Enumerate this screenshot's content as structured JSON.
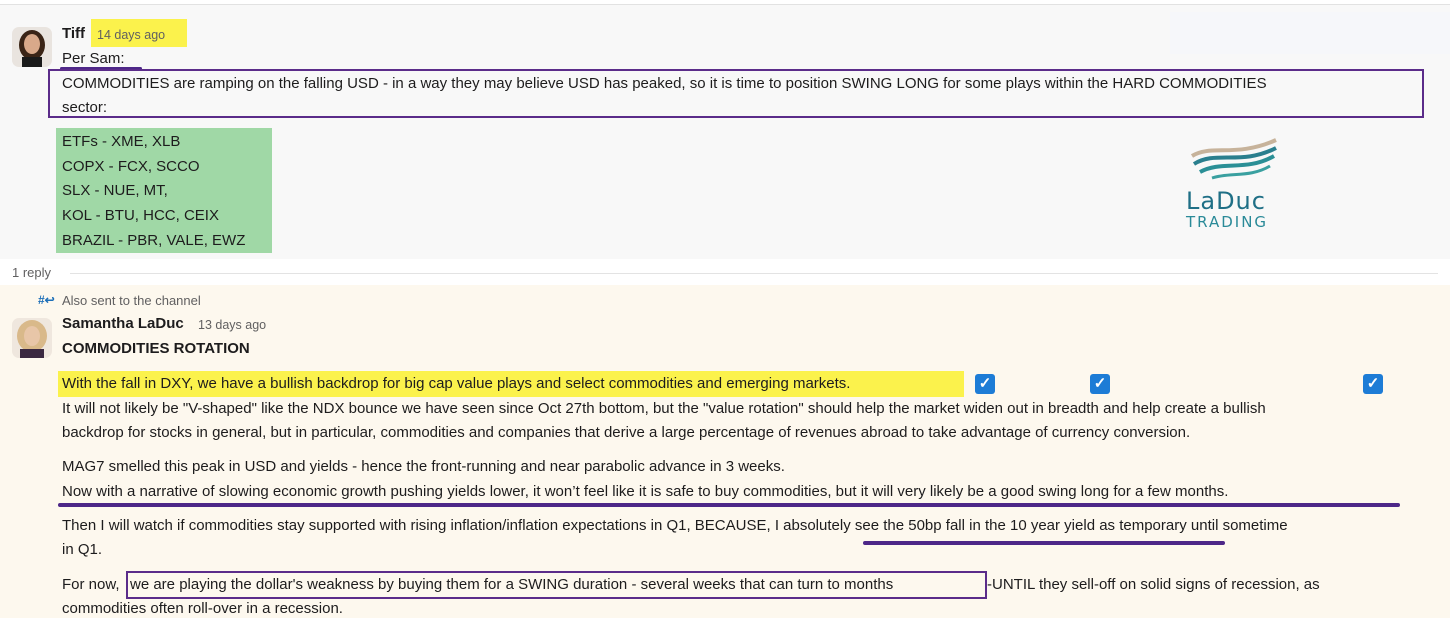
{
  "message1": {
    "author": "Tiff",
    "timestamp": "14 days ago",
    "lines": [
      "Per Sam:",
      "COMMODITIES are ramping on the falling USD - in a way they may believe USD has peaked, so it is time to position SWING LONG for some plays within the HARD COMMODITIES",
      "sector:"
    ],
    "list": [
      "ETFs - XME, XLB",
      "COPX - FCX, SCCO",
      "SLX - NUE, MT,",
      "KOL - BTU, HCC, CEIX",
      "BRAZIL - PBR, VALE, EWZ"
    ],
    "logo": {
      "line1": "LaDuc",
      "line2": "TRADING"
    }
  },
  "thread": {
    "reply_count": "1 reply"
  },
  "message2": {
    "also_sent": "Also sent to the channel",
    "author": "Samantha LaDuc",
    "timestamp": "13 days ago",
    "title": "COMMODITIES ROTATION",
    "highlight": "With the fall in DXY, we have a bullish backdrop for big cap value plays and select commodities and emerging markets.",
    "checks": [
      "✓",
      "✓",
      "✓"
    ],
    "p1a": "It will not likely be \"V-shaped\" like the NDX bounce we have seen since Oct 27th bottom, but the \"value rotation\" should help the market widen out in breadth and help create a bullish",
    "p1b": "backdrop for stocks in general, but in particular, commodities and companies that derive a large percentage of revenues abroad to take advantage of currency conversion.",
    "p2a": "MAG7 smelled this peak in USD and yields - hence the front-running and near parabolic advance in 3 weeks.",
    "p2b": "Now with a narrative of slowing economic growth pushing yields lower, it won’t feel like it is safe to buy commodities, but it will very likely be a good swing long for a few months.",
    "p3a": "Then I will watch if commodities stay supported with rising inflation/inflation expectations in Q1, BECAUSE, I absolutely see the 50bp fall in the 10 year yield as temporary until sometime",
    "p3b": "in Q1.",
    "p4a_pre": "For now,",
    "p4a_box": "we are playing the dollar's weakness by buying them for a SWING duration - several weeks that can turn to months",
    "p4a_post": "-UNTIL they sell-off on solid signs of recession, as",
    "p4b": "commodities often roll-over in a recession."
  },
  "colors": {
    "highlight_yellow": "#fbf24c",
    "highlight_green": "#a0d8a6",
    "annotation_purple": "#5b2c8a",
    "check_blue": "#1d7cd6"
  }
}
